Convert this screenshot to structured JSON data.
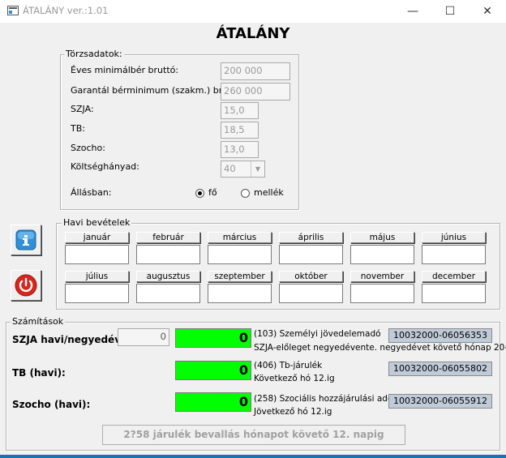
{
  "window": {
    "title": "ÁTALÁNY ver.:1.01",
    "minimize_glyph": "—",
    "maximize_glyph": "☐",
    "close_glyph": "✕"
  },
  "app_heading": "ÁTALÁNY",
  "torzsadatok": {
    "legend": "Törzsadatok:",
    "fields": [
      {
        "label": "Éves minimálbér bruttó:",
        "value": "200 000"
      },
      {
        "label": "Garantál bérminimum (szakm.) bruttó:",
        "value": "260 000"
      },
      {
        "label": "SZJA:",
        "value": "15,0"
      },
      {
        "label": "TB:",
        "value": "18,5"
      },
      {
        "label": "Szocho:",
        "value": "13,0"
      },
      {
        "label": "Költséghányad:",
        "value": "40"
      }
    ],
    "allasban_label": "Állásban:",
    "options": [
      {
        "label": "fő",
        "selected": true
      },
      {
        "label": "mellék",
        "selected": false
      }
    ]
  },
  "havi": {
    "legend": "Havi bevételek",
    "months": [
      "január",
      "február",
      "március",
      "április",
      "május",
      "június",
      "július",
      "augusztus",
      "szeptember",
      "október",
      "november",
      "december"
    ]
  },
  "sidebar": {
    "info_icon": "info-icon",
    "power_icon": "power-icon"
  },
  "szamitasok": {
    "legend": "Számítások",
    "rows": [
      {
        "label": "SZJA havi/negyedévi:",
        "small_value": "0",
        "value": "0",
        "code": "(103) Személyi jövedelemadó",
        "note": "SZJA-előleget negyedévente. negyedévet követő hónap 20-ig",
        "account": "10032000-06056353"
      },
      {
        "label": "TB (havi):",
        "value": "0",
        "code": "(406) Tb-járulék",
        "note": "Következő hó 12.ig",
        "account": "10032000-06055802"
      },
      {
        "label": "Szocho (havi):",
        "value": "0",
        "code": "(258) Szociális hozzájárulási adó",
        "note": "Jövetkező hó 12.ig",
        "account": "10032000-06055912"
      }
    ],
    "bottom_button": "2?58 járulék bevallás hónapot követő 12. napig"
  },
  "colors": {
    "green": "#00ff00",
    "account_bg": "#bfcbd9",
    "power_red": "#d9251d",
    "info_blue": "#2f8fd8"
  }
}
